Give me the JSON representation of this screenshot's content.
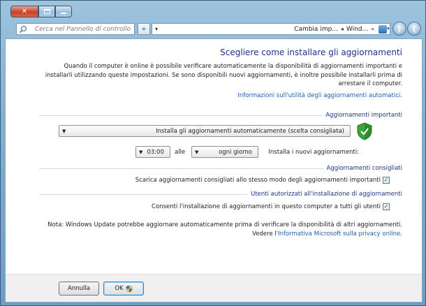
{
  "window": {
    "close_label": "✕"
  },
  "address_bar": {
    "search_placeholder": "Cerca nel Pannello di controllo",
    "refresh_symbol": "+",
    "crumbs": [
      "Wind...",
      "Cambia imp..."
    ],
    "crumb_sep": "«",
    "dropdown_symbol": "▾",
    "back_symbol": "◀",
    "forward_symbol": "▶"
  },
  "page": {
    "title": "Scegliere come installare gli aggiornamenti",
    "description": "Quando il computer è online è possibile verificare automaticamente la disponibilità di aggiornamenti importanti e installarli utilizzando queste impostazioni. Se sono disponibili nuovi aggiornamenti, è inoltre possibile installarli prima di arrestare il computer.",
    "info_link": "Informazioni sull'utilità degli aggiornamenti automatici.",
    "important": {
      "heading": "Aggiornamenti importanti",
      "select_value": "Installa gli aggiornamenti automaticamente (scelta consigliata)",
      "install_label": "Installa i nuovi aggiornamenti:",
      "day_value": "ogni giorno",
      "at_label": "alle",
      "time_value": "03:00"
    },
    "recommended": {
      "heading": "Aggiornamenti consigliati",
      "checkbox_label": "Scarica aggiornamenti consigliati allo stesso modo degli aggiornamenti importanti",
      "checked": true
    },
    "authorized": {
      "heading": "Utenti autorizzati all'installazione di aggiornamenti",
      "checkbox_label": "Consenti l'installazione di aggiornamenti in questo computer a tutti gli utenti",
      "checked": true
    },
    "note_text": "Nota: Windows Update potrebbe aggiornare automaticamente prima di verificare la disponibilità di altri aggiornamenti. Vedere l'",
    "note_link": "Informativa Microsoft sulla privacy online",
    "note_end": "."
  },
  "buttons": {
    "ok": "OK",
    "cancel": "Annulla"
  },
  "colors": {
    "title": "#1e3287",
    "link": "#1b5fb6",
    "shield": "#3aa63a"
  }
}
